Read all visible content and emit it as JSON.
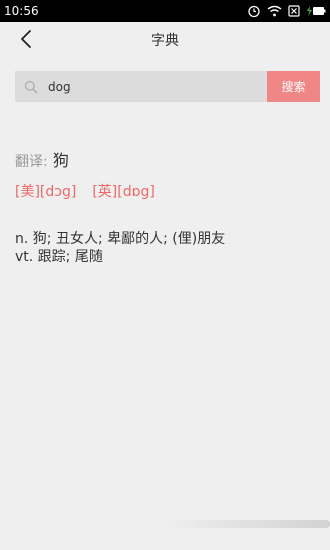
{
  "status_bar": {
    "time": "10:56",
    "icons": [
      "alarm-icon",
      "wifi-icon",
      "sim-x-icon",
      "battery-charging-icon"
    ]
  },
  "app_bar": {
    "back_icon": "chevron-left-icon",
    "title": "字典"
  },
  "search": {
    "value": "dog",
    "button_label": "搜索",
    "icon": "search-icon",
    "accent_color": "#f08686"
  },
  "result": {
    "translation_label": "翻译:",
    "translation_value": "狗",
    "phonetics": [
      "[美][dɔg]",
      "[英][dɒg]"
    ],
    "definitions": [
      "n. 狗; 丑女人; 卑鄙的人; (俚)朋友",
      "vt. 跟踪; 尾随"
    ],
    "phonetic_color": "#e96a6a"
  }
}
